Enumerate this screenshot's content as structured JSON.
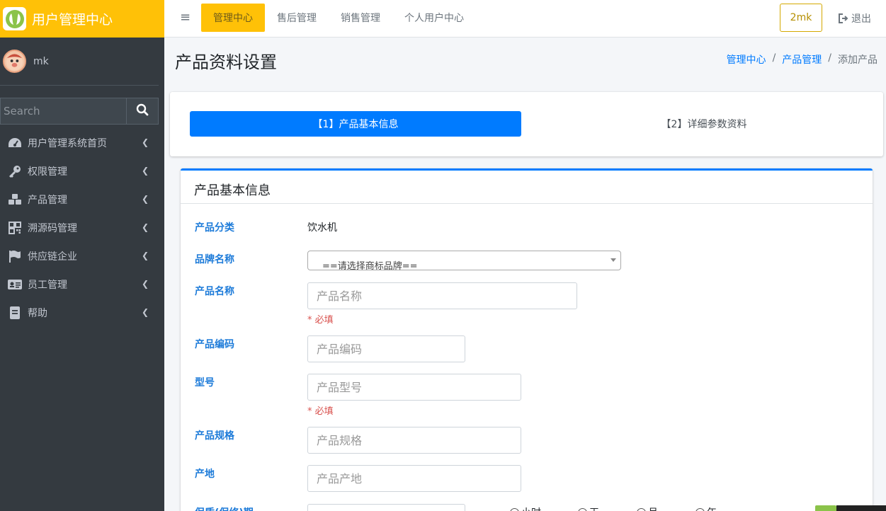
{
  "app": {
    "title": "用户管理中心",
    "logo_icon": "leaf-logo-icon",
    "accent_color": "#ffc107",
    "primary_color": "#007bff"
  },
  "user": {
    "name": "mk"
  },
  "search": {
    "placeholder": "Search",
    "value": ""
  },
  "sidebar": {
    "items": [
      {
        "label": "用户管理系统首页",
        "icon": "tachometer-icon"
      },
      {
        "label": "权限管理",
        "icon": "key-icon"
      },
      {
        "label": "产品管理",
        "icon": "cubes-icon"
      },
      {
        "label": "溯源码管理",
        "icon": "qrcode-icon"
      },
      {
        "label": "供应链企业",
        "icon": "flag-icon"
      },
      {
        "label": "员工管理",
        "icon": "id-card-icon"
      },
      {
        "label": "帮助",
        "icon": "book-icon"
      }
    ]
  },
  "topbar": {
    "menu_toggle": "≡",
    "nav": [
      {
        "label": "管理中心",
        "active": true
      },
      {
        "label": "售后管理",
        "active": false
      },
      {
        "label": "销售管理",
        "active": false
      },
      {
        "label": "个人用户中心",
        "active": false
      }
    ],
    "user_button": "2mk",
    "logout_label": "退出"
  },
  "header": {
    "title": "产品资料设置",
    "breadcrumb": {
      "home": "管理中心",
      "section": "产品管理",
      "current": "添加产品",
      "separator": "/"
    }
  },
  "steps": {
    "step1": "【1】产品基本信息",
    "step2": "【2】详细参数资料"
  },
  "form": {
    "card_title": "产品基本信息",
    "required_note": "* 必填",
    "category": {
      "label": "产品分类",
      "value": "饮水机"
    },
    "brand": {
      "label": "品牌名称",
      "value": "==请选择商标品牌=="
    },
    "name": {
      "label": "产品名称",
      "placeholder": "产品名称"
    },
    "code": {
      "label": "产品编码",
      "placeholder": "产品编码"
    },
    "model": {
      "label": "型号",
      "placeholder": "产品型号"
    },
    "spec": {
      "label": "产品规格",
      "placeholder": "产品规格"
    },
    "origin": {
      "label": "产地",
      "placeholder": "产品产地"
    },
    "warranty": {
      "label": "保质(保修)期",
      "units": [
        "小时",
        "天",
        "月",
        "年"
      ]
    }
  }
}
